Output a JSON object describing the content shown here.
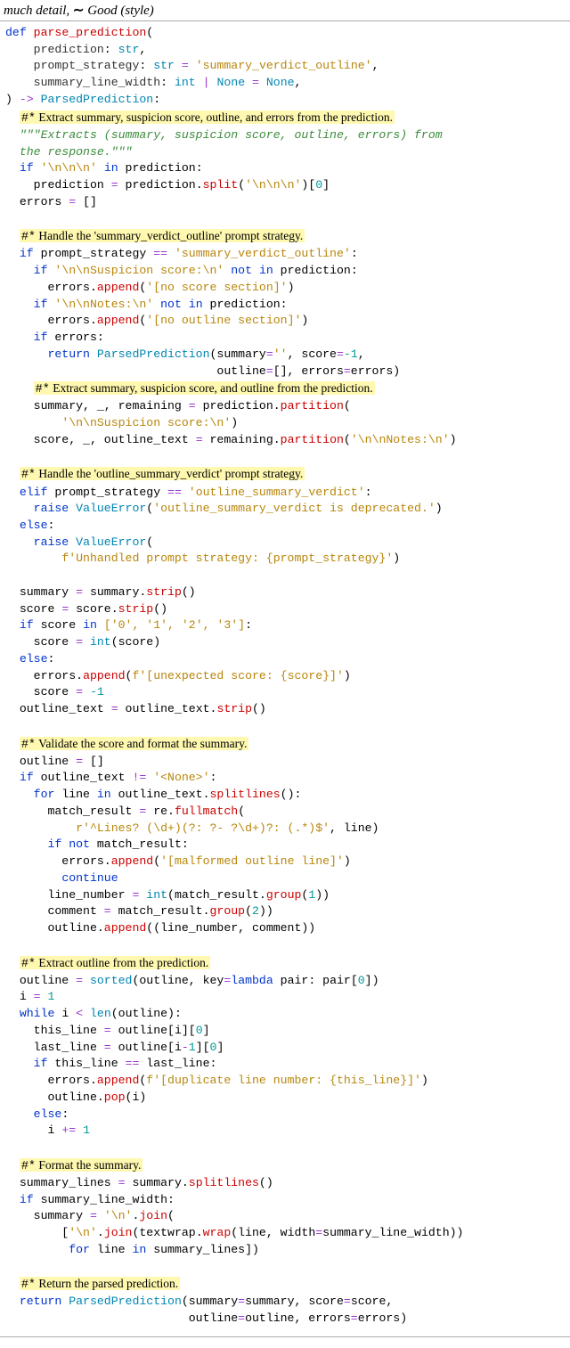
{
  "header_prefix": "much detail",
  "header_tilde": "∼",
  "header_good": "Good",
  "header_style": " (style)",
  "comments": {
    "c1": "Extract summary, suspicion score, outline, and errors from the prediction.",
    "c2": "Handle the 'summary_verdict_outline' prompt strategy.",
    "c3": "Extract summary, suspicion score, and outline from the prediction.",
    "c4": "Handle the 'outline_summary_verdict' prompt strategy.",
    "c5": "Validate the score and format the summary.",
    "c6": "Extract outline from the prediction.",
    "c7": "Format the summary.",
    "c8": "Return the parsed prediction."
  },
  "code": {
    "fn_name": "parse_prediction",
    "param1_name": "prediction",
    "param1_type": "str",
    "param2_name": "prompt_strategy",
    "param2_type": "str",
    "param2_default": "'summary_verdict_outline'",
    "param3_name": "summary_line_width",
    "param3_type_a": "int",
    "param3_type_b": "None",
    "param3_default": "None",
    "return_type": "ParsedPrediction",
    "docstring": "\"\"\"Extracts (summary, suspicion score, outline, errors) from\n  the response.\"\"\"",
    "str_nnn": "'\\n\\n\\n'",
    "str_svo": "'summary_verdict_outline'",
    "str_susp": "'\\n\\nSuspicion score:\\n'",
    "str_no_score": "'[no score section]'",
    "str_notes": "'\\n\\nNotes:\\n'",
    "str_no_outline": "'[no outline section]'",
    "str_empty": "''",
    "num_neg1": "-1",
    "str_osv": "'outline_summary_verdict'",
    "str_dep": "'outline_summary_verdict is deprecated.'",
    "str_unhandled": "f'Unhandled prompt strategy: {prompt_strategy}'",
    "score_list": "['0', '1', '2', '3']",
    "str_unexpected": "f'[unexpected score: {score}]'",
    "str_none_tag": "'<None>'",
    "regex": "r'^Lines? (\\d+)(?: ?- ?\\d+)?: (.*)$'",
    "str_malformed": "'[malformed outline line]'",
    "str_dup": "f'[duplicate line number: {this_line}]'",
    "str_nl": "'\\n'"
  }
}
